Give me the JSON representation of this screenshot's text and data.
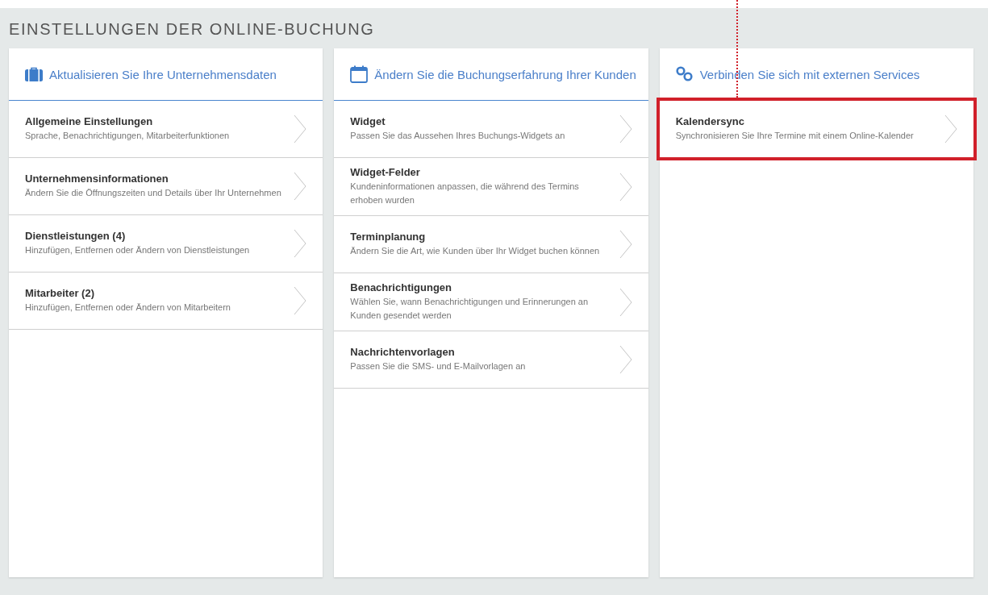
{
  "title": "EINSTELLUNGEN DER ONLINE-BUCHUNG",
  "columns": [
    {
      "heading": "Aktualisieren Sie Ihre Unternehmensdaten",
      "items": [
        {
          "title": "Allgemeine Einstellungen",
          "description": "Sprache, Benachrichtigungen, Mitarbeiterfunktionen",
          "highlighted": false
        },
        {
          "title": "Unternehmensinformationen",
          "description": "Ändern Sie die Öffnungszeiten und Details über Ihr Unternehmen",
          "highlighted": false
        },
        {
          "title": "Dienstleistungen (4)",
          "description": "Hinzufügen, Entfernen oder Ändern von Dienstleistungen",
          "highlighted": false
        },
        {
          "title": "Mitarbeiter (2)",
          "description": "Hinzufügen, Entfernen oder Ändern von Mitarbeitern",
          "highlighted": false
        }
      ]
    },
    {
      "heading": "Ändern Sie die Buchungserfahrung Ihrer Kunden",
      "items": [
        {
          "title": "Widget",
          "description": "Passen Sie das Aussehen Ihres Buchungs-Widgets an",
          "highlighted": false
        },
        {
          "title": "Widget-Felder",
          "description": "Kundeninformationen anpassen, die während des Termins erhoben wurden",
          "highlighted": false
        },
        {
          "title": "Terminplanung",
          "description": "Ändern Sie die Art, wie Kunden über Ihr Widget buchen können",
          "highlighted": false
        },
        {
          "title": "Benachrichtigungen",
          "description": "Wählen Sie, wann Benachrichtigungen und Erinnerungen an Kunden gesendet werden",
          "highlighted": false
        },
        {
          "title": "Nachrichtenvorlagen",
          "description": "Passen Sie die SMS- und E-Mailvorlagen an",
          "highlighted": false
        }
      ]
    },
    {
      "heading": "Verbinden Sie sich mit externen Services",
      "items": [
        {
          "title": "Kalendersync",
          "description": "Synchronisieren Sie Ihre Termine mit einem Online-Kalender",
          "highlighted": true
        }
      ]
    }
  ]
}
